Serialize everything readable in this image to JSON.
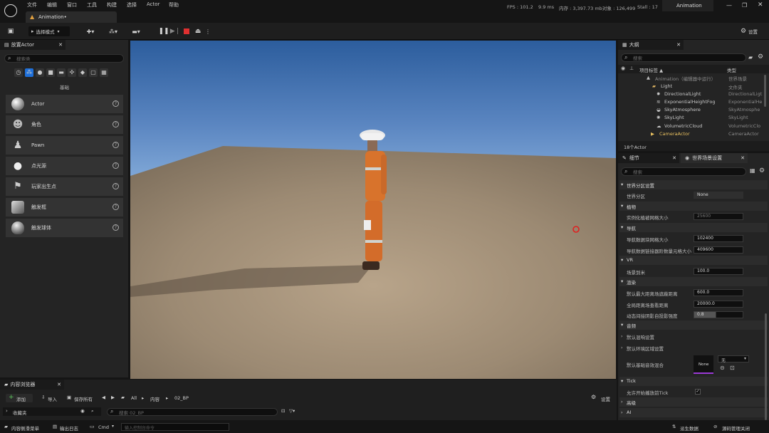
{
  "menu": [
    "文件",
    "编辑",
    "窗口",
    "工具",
    "构建",
    "选择",
    "Actor",
    "帮助"
  ],
  "tab": {
    "title": "Animation•"
  },
  "stats": {
    "fps": "FPS : 101.2",
    "ms": "9.9 ms",
    "mem": "内存 : 3,397.73 mb",
    "objects": "对象 : 126,499",
    "stall": "Stall : 17"
  },
  "project_name": "Animation",
  "toolbar": {
    "mode": "选择模式",
    "settings": "设置"
  },
  "place_actors": {
    "tab": "放置Actor",
    "search_placeholder": "搜索类",
    "category": "基础",
    "items": [
      "Actor",
      "角色",
      "Pawn",
      "点光源",
      "玩家出生点",
      "触发框",
      "触发球体"
    ]
  },
  "outliner": {
    "tab": "大纲",
    "search_placeholder": "搜索",
    "col_label": "项目标签 ▲",
    "col_type": "类型",
    "rows": [
      {
        "name": "Animation（编辑器中运行）",
        "type": "世界场景"
      },
      {
        "name": "Light",
        "type": "文件夹"
      },
      {
        "name": "DirectionalLight",
        "type": "DirectionalLigt"
      },
      {
        "name": "ExponentialHeightFog",
        "type": "ExponentialHe"
      },
      {
        "name": "SkyAtmosphere",
        "type": "SkyAtmosphe"
      },
      {
        "name": "SkyLight",
        "type": "SkyLight"
      },
      {
        "name": "VolumetricCloud",
        "type": "VolumetricClo"
      },
      {
        "name": "CameraActor",
        "type": "CameraActor"
      }
    ],
    "count": "18个Actor"
  },
  "details": {
    "tab_details": "细节",
    "tab_world": "世界场景设置",
    "search_placeholder": "搜索",
    "sections": {
      "partition": "世界分区设置",
      "foliage": "植物",
      "navigation": "导航",
      "vr": "VR",
      "rendering": "渲染",
      "audio": "音频",
      "tick": "Tick",
      "advanced": "高级",
      "ai": "AI"
    },
    "props": {
      "world_partition": {
        "k": "世界分区",
        "v": "None"
      },
      "instanced_grid": {
        "k": "实例化植被网格大小",
        "v": "25600"
      },
      "nav_grid": {
        "k": "导航数据块网格大小",
        "v": "102400"
      },
      "nav_data": {
        "k": "导航数据链接器阶数量元格大小",
        "v": "409600"
      },
      "world_to_meters": {
        "k": "场景到米",
        "v": "100.0"
      },
      "max_draw": {
        "k": "默认最大距离场遮蔽距离",
        "v": "600.0"
      },
      "global_field": {
        "k": "全局距离场查看距离",
        "v": "20000.0"
      },
      "dyn_indirect": {
        "k": "动态间接阴影自投影强度",
        "v": "0.8"
      },
      "default_reverb": {
        "k": "默认混响设置"
      },
      "default_ambient": {
        "k": "默认环境区域设置"
      },
      "base_sound_mix": {
        "k": "默认基础音效混合",
        "v": "None",
        "dropdown": "无"
      },
      "tick_start": {
        "k": "允许开始播放前Tick"
      }
    }
  },
  "content_browser": {
    "tab": "内容浏览器",
    "add": "添加",
    "import": "导入",
    "save_all": "保存所有",
    "path": [
      "All",
      "内容",
      "02_BP"
    ],
    "settings": "设置",
    "folder": "收藏夹",
    "search_placeholder": "搜索 02_BP"
  },
  "statusbar": {
    "drawer": "内容侧滑菜单",
    "output_log": "输出日志",
    "cmd": "Cmd",
    "console_placeholder": "输入控制台命令",
    "derived_data": "派生数据",
    "source_control": "源码管理关闭"
  },
  "colors": {
    "accent": "#1e6fd9",
    "bg": "#151515",
    "panel": "#242424"
  }
}
